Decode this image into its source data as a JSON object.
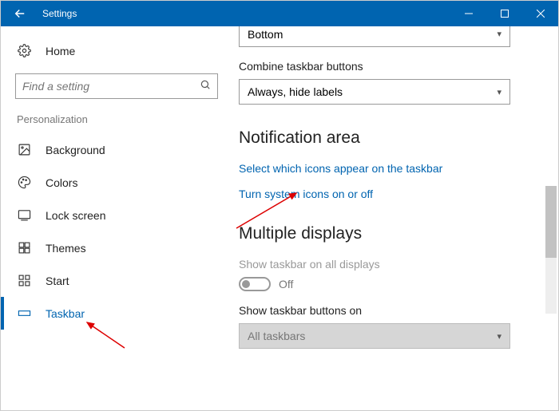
{
  "window": {
    "title": "Settings"
  },
  "sidebar": {
    "home": "Home",
    "search_placeholder": "Find a setting",
    "section": "Personalization",
    "items": [
      {
        "label": "Background"
      },
      {
        "label": "Colors"
      },
      {
        "label": "Lock screen"
      },
      {
        "label": "Themes"
      },
      {
        "label": "Start"
      },
      {
        "label": "Taskbar"
      }
    ]
  },
  "main": {
    "location_value": "Bottom",
    "combine_label": "Combine taskbar buttons",
    "combine_value": "Always, hide labels",
    "notification_heading": "Notification area",
    "link_select_icons": "Select which icons appear on the taskbar",
    "link_system_icons": "Turn system icons on or off",
    "multiple_heading": "Multiple displays",
    "show_all_label": "Show taskbar on all displays",
    "toggle_state": "Off",
    "show_buttons_label": "Show taskbar buttons on",
    "show_buttons_value": "All taskbars"
  }
}
